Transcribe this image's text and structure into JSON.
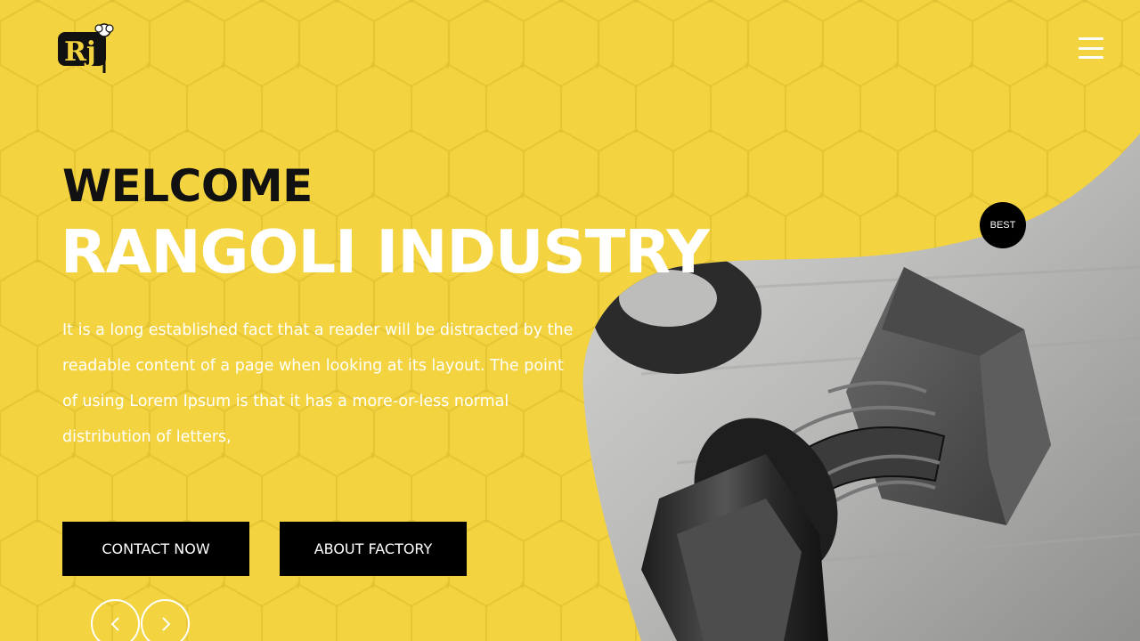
{
  "brand": {
    "logo_text": "Rj",
    "logo_icon": "cotton-flower-icon"
  },
  "header": {
    "menu_icon": "hamburger-menu-icon"
  },
  "hero": {
    "welcome": "WELCOME",
    "title": "RANGOLI INDUSTRY",
    "description": "It is a long established fact that a reader will be distracted by the readable content of a page when looking at its layout. The point of using Lorem Ipsum is that it has a more-or-less normal distribution of letters,",
    "image_subject": "bolt-nut-washer-photo"
  },
  "buttons": {
    "contact": "CONTACT NOW",
    "about": "ABOUT FACTORY"
  },
  "slider": {
    "prev_icon": "chevron-left-icon",
    "next_icon": "chevron-right-icon"
  },
  "badge": {
    "label": "BEST"
  },
  "colors": {
    "background": "#f3d33f",
    "text_dark": "#111111",
    "text_light": "#ffffff",
    "button_bg": "#000000"
  }
}
